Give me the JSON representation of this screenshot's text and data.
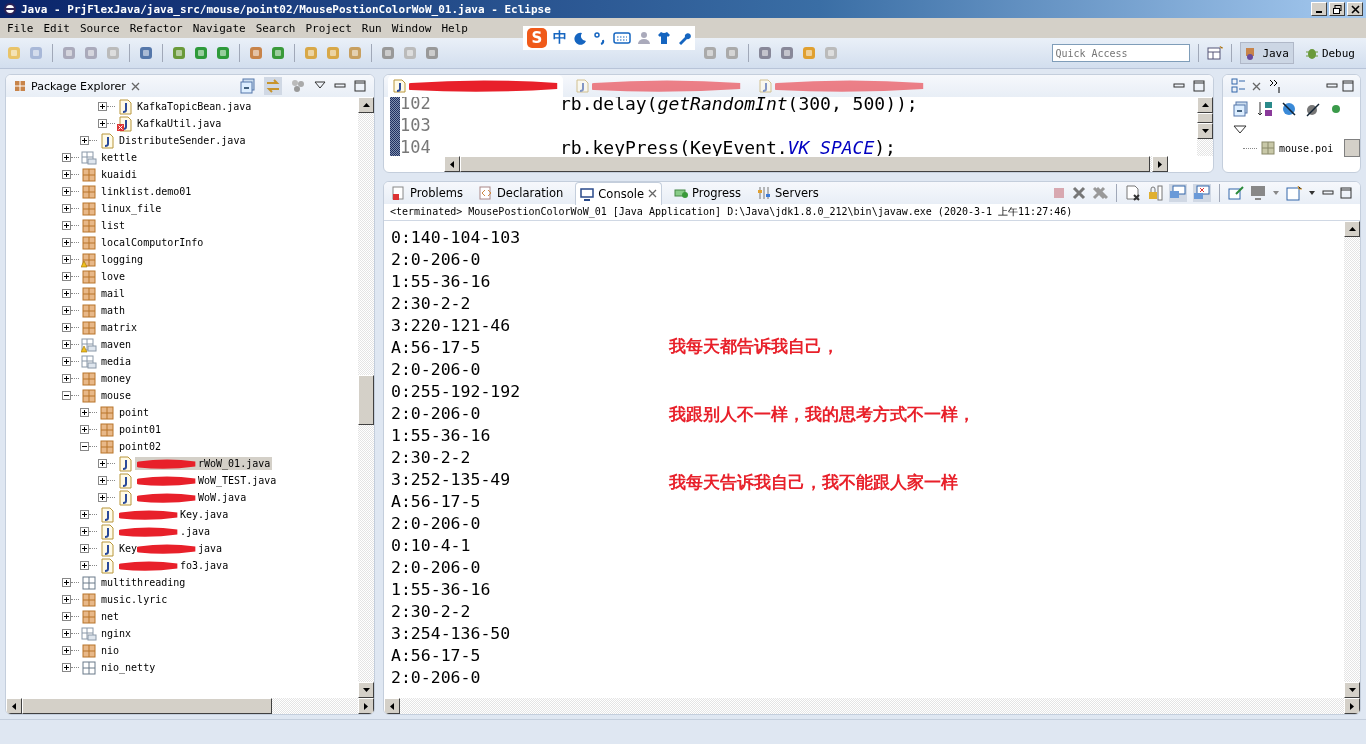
{
  "window": {
    "title": "Java - PrjFlexJava/java_src/mouse/point02/MousePostionColorWoW_01.java - Eclipse"
  },
  "menu": [
    "File",
    "Edit",
    "Source",
    "Refactor",
    "Navigate",
    "Search",
    "Project",
    "Run",
    "Window",
    "Help"
  ],
  "ime_bar": {
    "logo": "S",
    "mode": "中"
  },
  "quick_access": {
    "placeholder": "Quick Access"
  },
  "perspectives": [
    {
      "label": "Java",
      "selected": true
    },
    {
      "label": "Debug",
      "selected": false
    }
  ],
  "package_explorer": {
    "title": "Package Explorer",
    "tree": [
      {
        "children": [
          {
            "children": [
              {
                "label": "KafkaTopicBean.java",
                "kind": "java",
                "expanded": false,
                "selected": false
              },
              {
                "label": "KafkaUtil.java",
                "kind": "java-error",
                "expanded": false,
                "selected": false
              }
            ]
          },
          {
            "label": "DistributeSender.java",
            "kind": "java",
            "expanded": false,
            "selected": false
          }
        ]
      },
      {
        "label": "kettle",
        "kind": "folder",
        "expanded": false,
        "selected": false
      },
      {
        "label": "kuaidi",
        "kind": "package",
        "expanded": false,
        "selected": false
      },
      {
        "label": "linklist.demo01",
        "kind": "package",
        "expanded": false,
        "selected": false
      },
      {
        "label": "linux_file",
        "kind": "package",
        "expanded": false,
        "selected": false
      },
      {
        "label": "list",
        "kind": "package",
        "expanded": false,
        "selected": false
      },
      {
        "label": "localComputorInfo",
        "kind": "package",
        "expanded": false,
        "selected": false
      },
      {
        "label": "logging",
        "kind": "package-warning",
        "expanded": false,
        "selected": false
      },
      {
        "label": "love",
        "kind": "package",
        "expanded": false,
        "selected": false
      },
      {
        "label": "mail",
        "kind": "package",
        "expanded": false,
        "selected": false
      },
      {
        "label": "math",
        "kind": "package",
        "expanded": false,
        "selected": false
      },
      {
        "label": "matrix",
        "kind": "package",
        "expanded": false,
        "selected": false
      },
      {
        "label": "maven",
        "kind": "folder-warning",
        "expanded": false,
        "selected": false
      },
      {
        "label": "media",
        "kind": "folder",
        "expanded": false,
        "selected": false
      },
      {
        "label": "money",
        "kind": "package",
        "expanded": false,
        "selected": false
      },
      {
        "label": "mouse",
        "kind": "package",
        "expanded": true,
        "selected": false,
        "children": [
          {
            "label": "point",
            "kind": "package",
            "expanded": false,
            "selected": false
          },
          {
            "label": "point01",
            "kind": "package",
            "expanded": false,
            "selected": false
          },
          {
            "label": "point02",
            "kind": "package",
            "expanded": true,
            "selected": false,
            "children": [
              {
                "kind": "java",
                "redacted": true,
                "after": "rWoW_01.java",
                "expanded": false,
                "selected": true
              },
              {
                "kind": "java",
                "redacted": true,
                "after": "WoW_TEST.java",
                "expanded": false,
                "selected": false
              },
              {
                "kind": "java",
                "redacted": true,
                "after": "WoW.java",
                "expanded": false,
                "selected": false
              }
            ]
          },
          {
            "kind": "java",
            "redacted": true,
            "after": "Key.java",
            "expanded": false,
            "selected": false
          },
          {
            "kind": "java",
            "redacted": true,
            "after": ".java",
            "expanded": false,
            "selected": false
          },
          {
            "kind": "java",
            "redacted": true,
            "before": "Key",
            "after": "java",
            "expanded": false,
            "selected": false
          },
          {
            "kind": "java",
            "redacted": true,
            "after": "fo3.java",
            "expanded": false,
            "selected": false
          }
        ]
      },
      {
        "label": "multithreading",
        "kind": "empty-package",
        "expanded": false,
        "selected": false
      },
      {
        "label": "music.lyric",
        "kind": "package",
        "expanded": false,
        "selected": false
      },
      {
        "label": "net",
        "kind": "package",
        "expanded": false,
        "selected": false
      },
      {
        "label": "nginx",
        "kind": "folder",
        "expanded": false,
        "selected": false
      },
      {
        "label": "nio",
        "kind": "package",
        "expanded": false,
        "selected": false
      },
      {
        "label": "nio_netty",
        "kind": "empty-package",
        "expanded": false,
        "selected": false
      }
    ]
  },
  "editor": {
    "tabs": [
      {
        "selected": true
      },
      {
        "selected": false
      },
      {
        "selected": false
      }
    ],
    "lines": [
      {
        "number": "102",
        "code": "rb.delay(",
        "call": "getRandomInt",
        "rest": "(300, 500));"
      },
      {
        "number": "103"
      },
      {
        "number": "104",
        "code": "rb.keyPress(KeyEvent.",
        "constant": "VK_SPACE",
        "rest": ");"
      }
    ]
  },
  "outline": {
    "item": "mouse.poi"
  },
  "console_view": {
    "tabs": [
      {
        "label": "Problems",
        "selected": false
      },
      {
        "label": "Declaration",
        "selected": false
      },
      {
        "label": "Console",
        "selected": true
      },
      {
        "label": "Progress",
        "selected": false
      },
      {
        "label": "Servers",
        "selected": false
      }
    ],
    "status": "<terminated> MousePostionColorWoW_01 [Java Application] D:\\Java\\jdk1.8.0_212\\bin\\javaw.exe (2020-3-1 上午11:27:46)",
    "output": [
      "0:140-104-103",
      "2:0-206-0",
      "1:55-36-16",
      "2:30-2-2",
      "3:220-121-46",
      "A:56-17-5",
      "2:0-206-0",
      "0:255-192-192",
      "2:0-206-0",
      "1:55-36-16",
      "2:30-2-2",
      "3:252-135-49",
      "A:56-17-5",
      "2:0-206-0",
      "0:10-4-1",
      "2:0-206-0",
      "1:55-36-16",
      "2:30-2-2",
      "3:254-136-50",
      "A:56-17-5",
      "2:0-206-0"
    ],
    "notes": [
      "我每天都告诉我自己，",
      "我跟别人不一样，我的思考方式不一样，",
      "我每天告诉我自己，我不能跟人家一样"
    ]
  }
}
